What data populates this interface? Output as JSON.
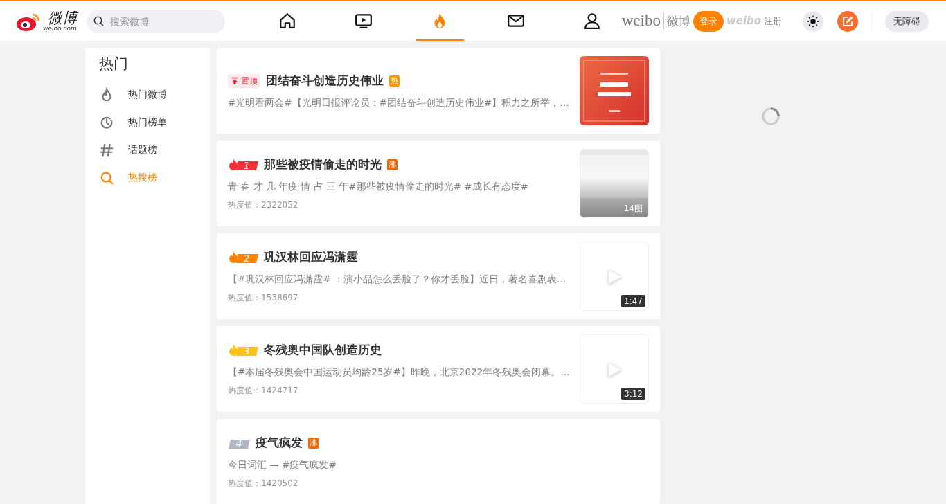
{
  "header": {
    "logo": {
      "name": "微博",
      "domain": "weibo.com"
    },
    "search": {
      "placeholder": "搜索微博"
    },
    "nav": [
      {
        "kind": "home",
        "selected": false
      },
      {
        "kind": "video",
        "selected": false
      },
      {
        "kind": "fire",
        "selected": true
      },
      {
        "kind": "mail",
        "selected": false
      },
      {
        "kind": "user",
        "selected": false
      }
    ],
    "brand": {
      "latin": "weibo",
      "chinese": "微博",
      "overlay": "weibo"
    },
    "login": "登录",
    "register": "注册",
    "accessibility": "无障碍"
  },
  "sidebar": {
    "title": "热门",
    "items": [
      {
        "kind": "flame",
        "label": "热门微博",
        "selected": false
      },
      {
        "kind": "clock",
        "label": "热门榜单",
        "selected": false
      },
      {
        "kind": "hash",
        "label": "话题榜",
        "selected": false
      },
      {
        "kind": "search",
        "label": "热搜榜",
        "selected": true
      }
    ]
  },
  "posts": [
    {
      "badge": {
        "kind": "pinned",
        "text": "置顶"
      },
      "title": "团结奋斗创造历史伟业",
      "tag": {
        "text": "热",
        "color": "#ff9406"
      },
      "summary": "#光明看两会#【光明日报评论员：#团结奋斗创造历史伟业#】积力之所举，…"
    },
    {
      "badge": {
        "kind": "rank",
        "text": "1",
        "color": "#f5323c"
      },
      "title": "那些被疫情偷走的时光",
      "tag": {
        "text": "沸",
        "color": "#f86400"
      },
      "summary": "青 春 才 几 年疫 情 占 三 年#那些被疫情偷走的时光# #成长有态度#",
      "heat": "热度值：2322052",
      "media": {
        "kind": "gallery",
        "caption": "14图"
      }
    },
    {
      "badge": {
        "kind": "rank",
        "text": "2",
        "color": "#ff8200"
      },
      "title": "巩汉林回应冯潇霆",
      "summary": "【#巩汉林回应冯潇霆# ：演小品怎么丢脸了？你才丢脸】近日，著名喜剧表…",
      "heat": "热度值：1538697",
      "media": {
        "kind": "video",
        "caption": "1:47"
      }
    },
    {
      "badge": {
        "kind": "rank",
        "text": "3",
        "color": "#ffc019"
      },
      "title": "冬残奥中国队创造历史",
      "summary": "【#本届冬残奥会中国运动员均龄25岁#】昨晚，北京2022年冬残奥会闭幕。…",
      "heat": "热度值：1424717",
      "media": {
        "kind": "video",
        "caption": "3:12"
      }
    },
    {
      "badge": {
        "kind": "plain",
        "text": "4",
        "color": "#b0b6c5"
      },
      "title": "疫气疯发",
      "tag": {
        "text": "沸",
        "color": "#f86400"
      },
      "summary": "今日词汇 — #疫气疯发#",
      "heat": "热度值：1420502"
    }
  ]
}
